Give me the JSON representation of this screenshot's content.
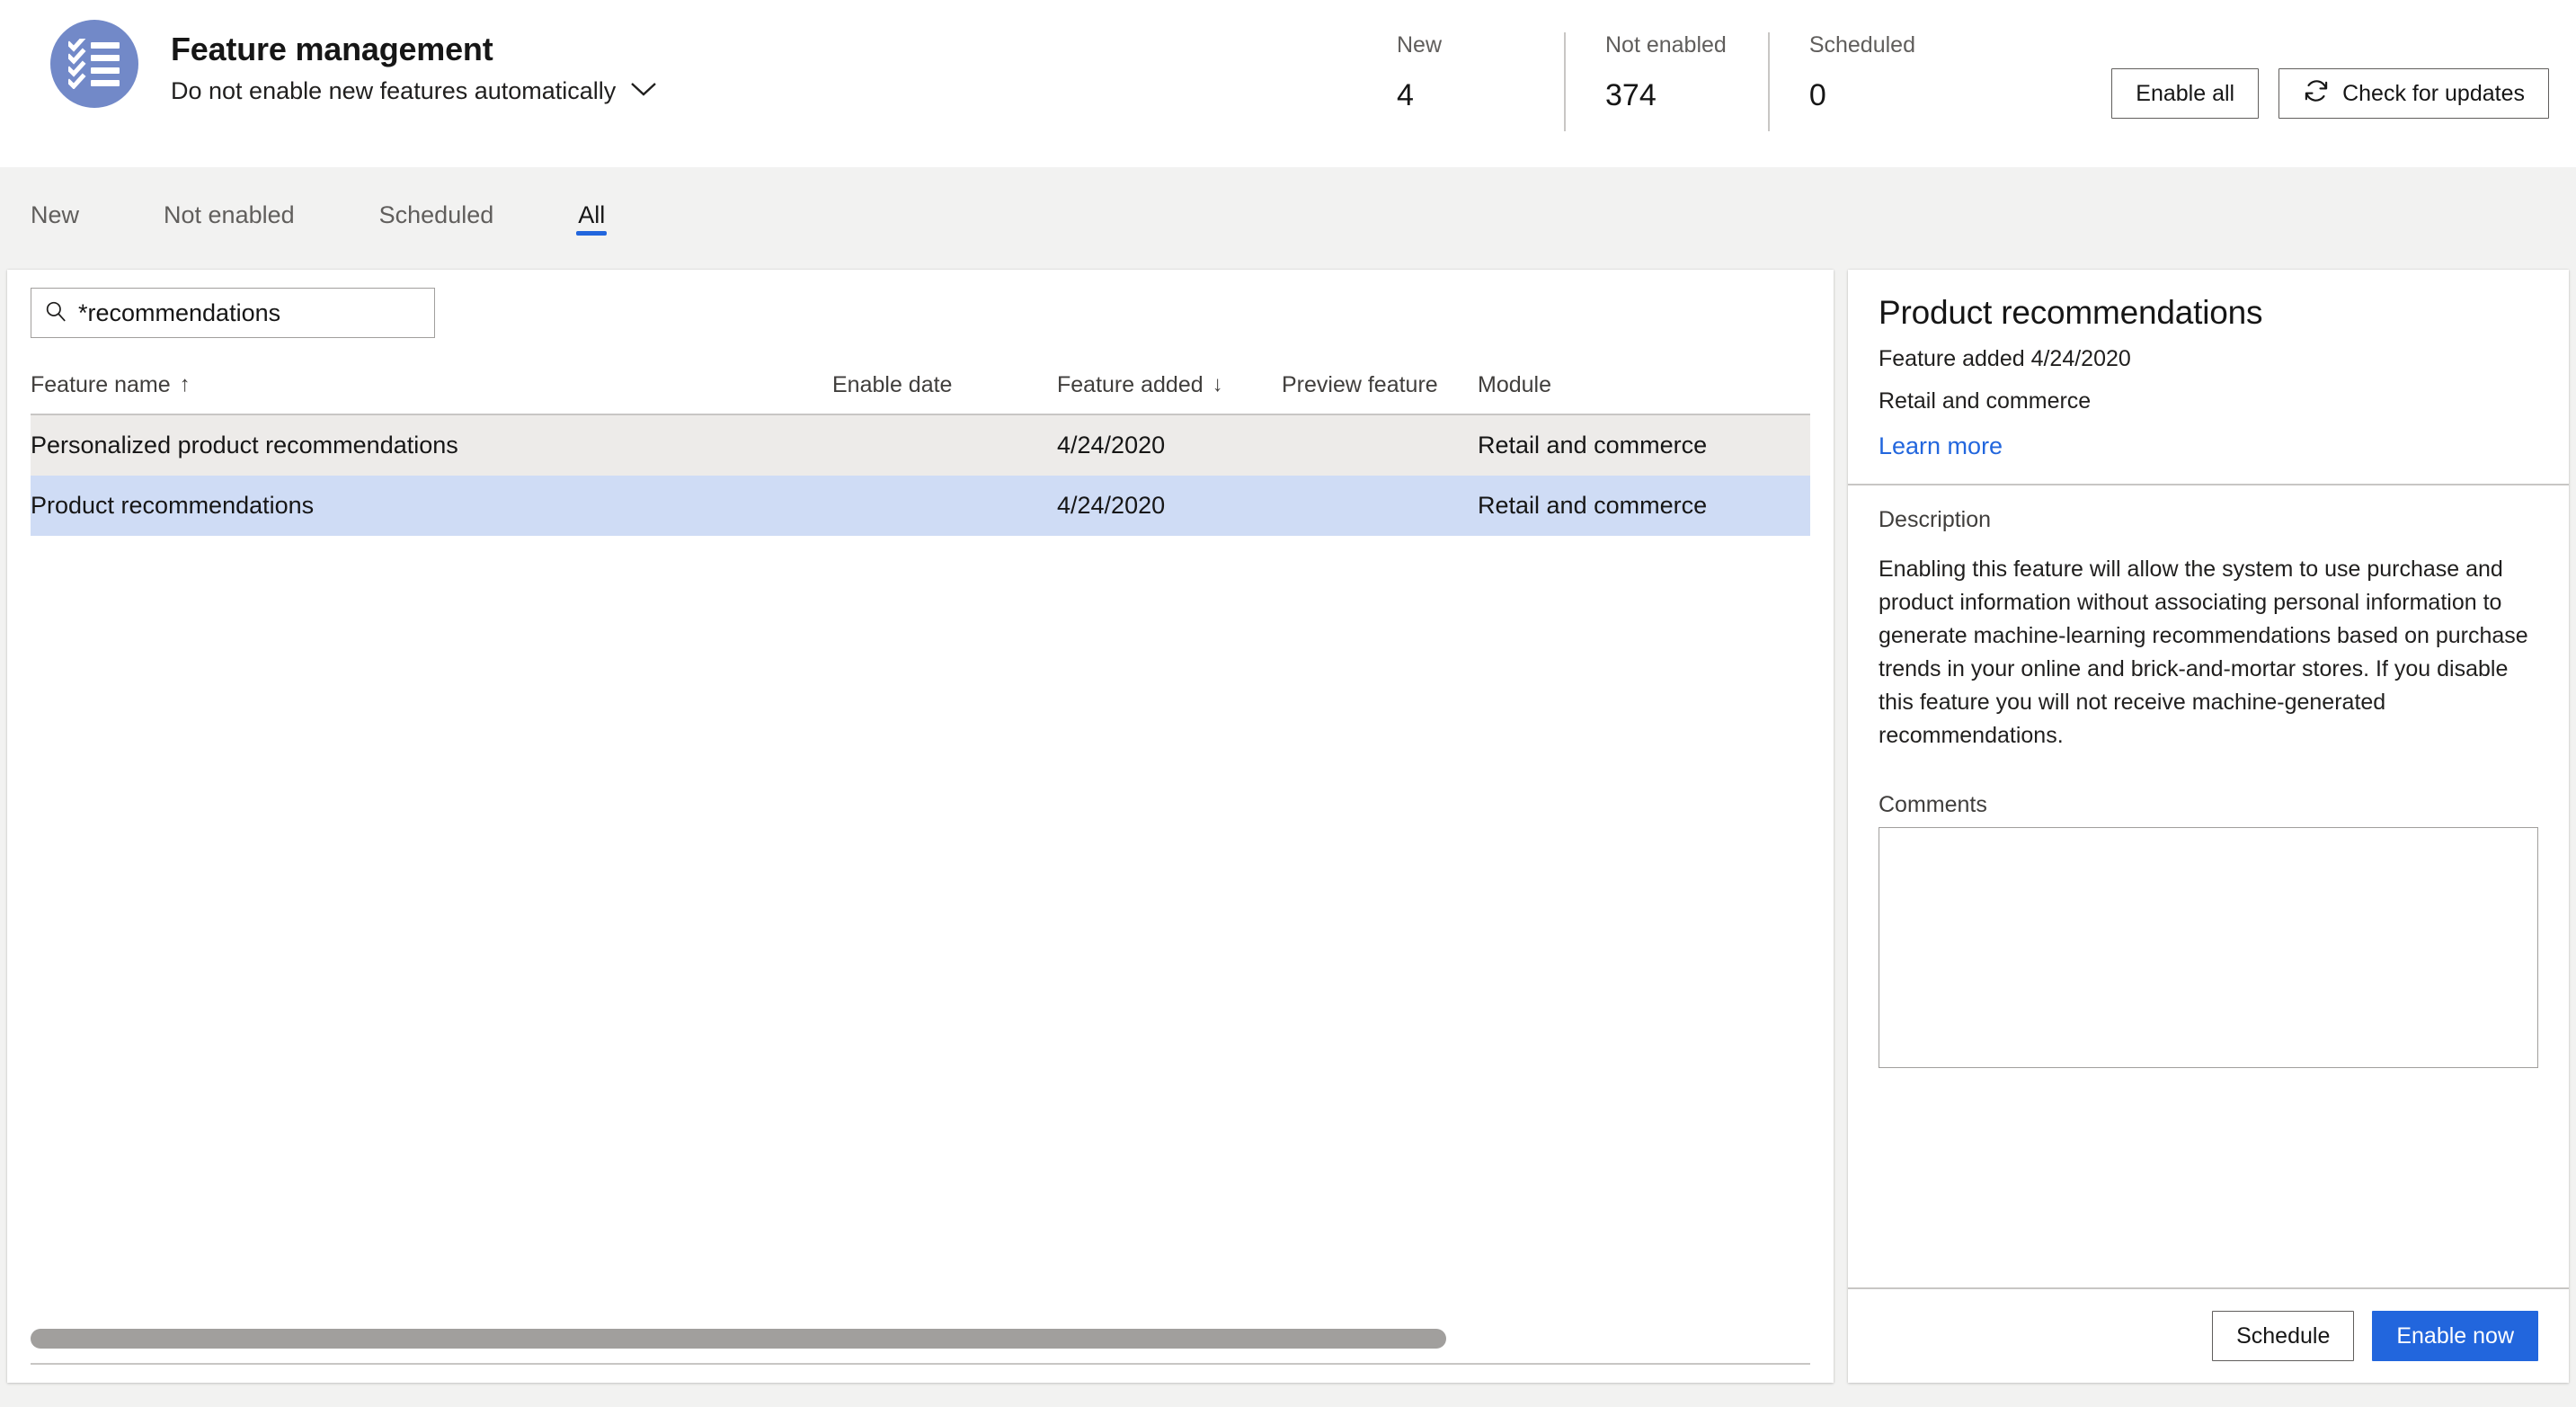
{
  "header": {
    "avatar_icon": "checklist-icon",
    "title": "Feature management",
    "subtitle": "Do not enable new features automatically",
    "chevron_icon": "chevron-down-icon",
    "stats": [
      {
        "label": "New",
        "value": "4"
      },
      {
        "label": "Not enabled",
        "value": "374"
      },
      {
        "label": "Scheduled",
        "value": "0"
      }
    ],
    "buttons": {
      "enable_all": "Enable all",
      "check_updates": "Check for updates",
      "refresh_icon": "refresh-icon"
    }
  },
  "tabs": [
    {
      "label": "New",
      "active": false
    },
    {
      "label": "Not enabled",
      "active": false
    },
    {
      "label": "Scheduled",
      "active": false
    },
    {
      "label": "All",
      "active": true
    }
  ],
  "search": {
    "icon": "search-icon",
    "value": "*recommendations",
    "placeholder": ""
  },
  "table": {
    "columns": [
      {
        "label": "Feature name",
        "sort": "↑"
      },
      {
        "label": "Enable date",
        "sort": ""
      },
      {
        "label": "Feature added",
        "sort": "↓"
      },
      {
        "label": "Preview feature",
        "sort": ""
      },
      {
        "label": "Module",
        "sort": ""
      }
    ],
    "rows": [
      {
        "feature_name": "Personalized product recommendations",
        "enable_date": "",
        "feature_added": "4/24/2020",
        "preview_feature": "",
        "module": "Retail and commerce",
        "state": "hovered"
      },
      {
        "feature_name": "Product recommendations",
        "enable_date": "",
        "feature_added": "4/24/2020",
        "preview_feature": "",
        "module": "Retail and commerce",
        "state": "selected"
      }
    ]
  },
  "detail": {
    "title": "Product recommendations",
    "added_line": "Feature added 4/24/2020",
    "module_line": "Retail and commerce",
    "learn_more": "Learn more",
    "description_label": "Description",
    "description": "Enabling this feature will allow the system to use purchase and product information without associating personal information to generate machine-learning recommendations based on purchase trends in your online and brick-and-mortar stores. If you disable this feature you will not receive machine-generated recommendations.",
    "comments_label": "Comments",
    "comments_value": "",
    "buttons": {
      "schedule": "Schedule",
      "enable_now": "Enable now"
    }
  },
  "colors": {
    "accent": "#2266dd",
    "avatar": "#7289c8",
    "selected_row": "#cfdcf5",
    "hover_row": "#edebe9",
    "page_bg": "#f2f2f1"
  }
}
